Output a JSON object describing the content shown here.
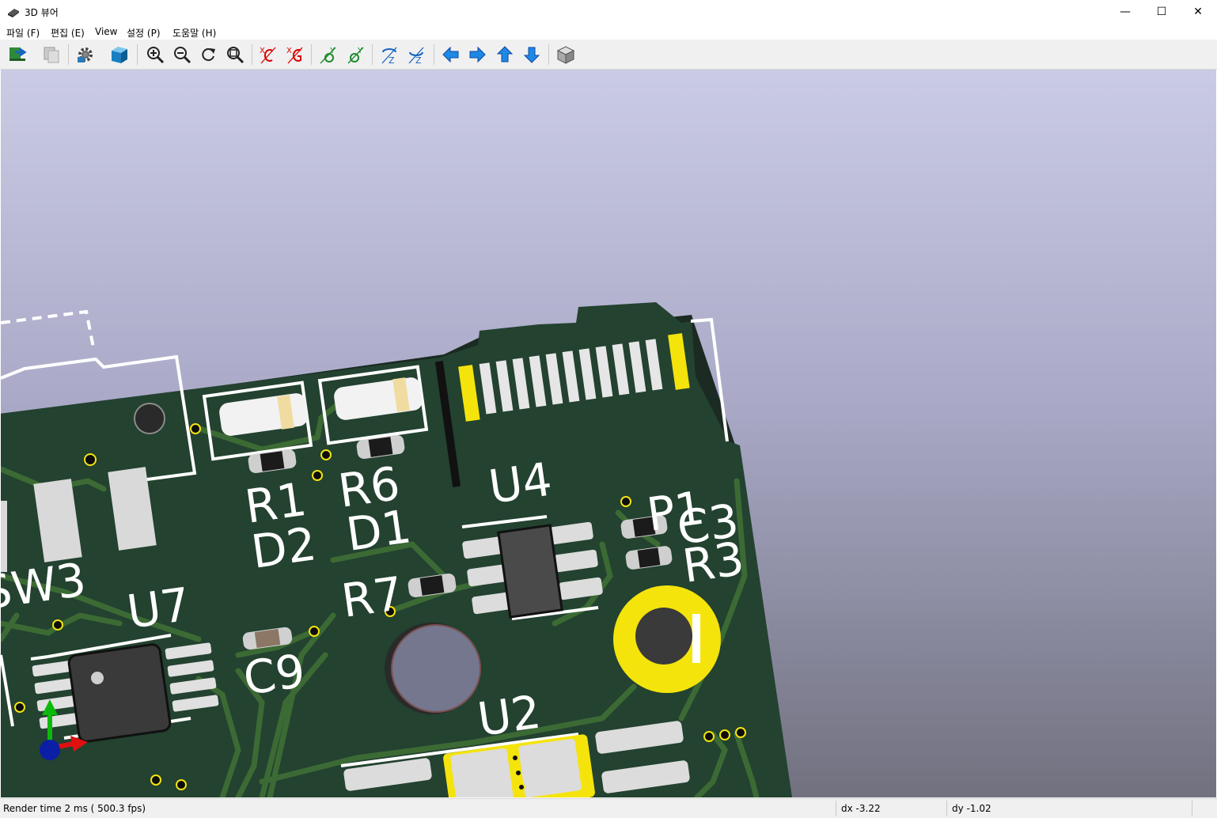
{
  "window": {
    "title": "3D 뷰어",
    "minimize": "—",
    "maximize": "☐",
    "close": "✕"
  },
  "menu": [
    {
      "label": "파일 (F)"
    },
    {
      "label": "편집 (E)"
    },
    {
      "label": "View"
    },
    {
      "label": "설정 (P)"
    },
    {
      "label": "도움말 (H)"
    }
  ],
  "toolbar": {
    "icons": [
      "reload-board-icon",
      "copy-image-icon",
      "settings-gear-icon",
      "render-mode-cube-icon",
      "zoom-in-icon",
      "zoom-out-icon",
      "redraw-icon",
      "zoom-fit-icon",
      "rotate-x-cw-icon",
      "rotate-x-ccw-icon",
      "rotate-y-cw-icon",
      "rotate-y-ccw-icon",
      "rotate-z-cw-icon",
      "rotate-z-ccw-icon",
      "pan-left-icon",
      "pan-right-icon",
      "pan-up-icon",
      "pan-down-icon",
      "orthographic-view-icon"
    ]
  },
  "board": {
    "refdes": [
      "R1",
      "R6",
      "D2",
      "D1",
      "U4",
      "P1",
      "C3",
      "R3",
      "R7",
      "SW3",
      "U7",
      "C9",
      "U2"
    ],
    "colors": {
      "board": "#234230",
      "trace": "#3c6a34",
      "silk": "#ffffff",
      "pad": "#e6e6e6",
      "gold": "#f4e40c",
      "background_top": "#cacbe4",
      "background_bottom": "#71717f"
    }
  },
  "status": {
    "render_time": "Render time 2 ms ( 500.3 fps)",
    "dx": "dx -3.22",
    "dy": "dy -1.02"
  }
}
